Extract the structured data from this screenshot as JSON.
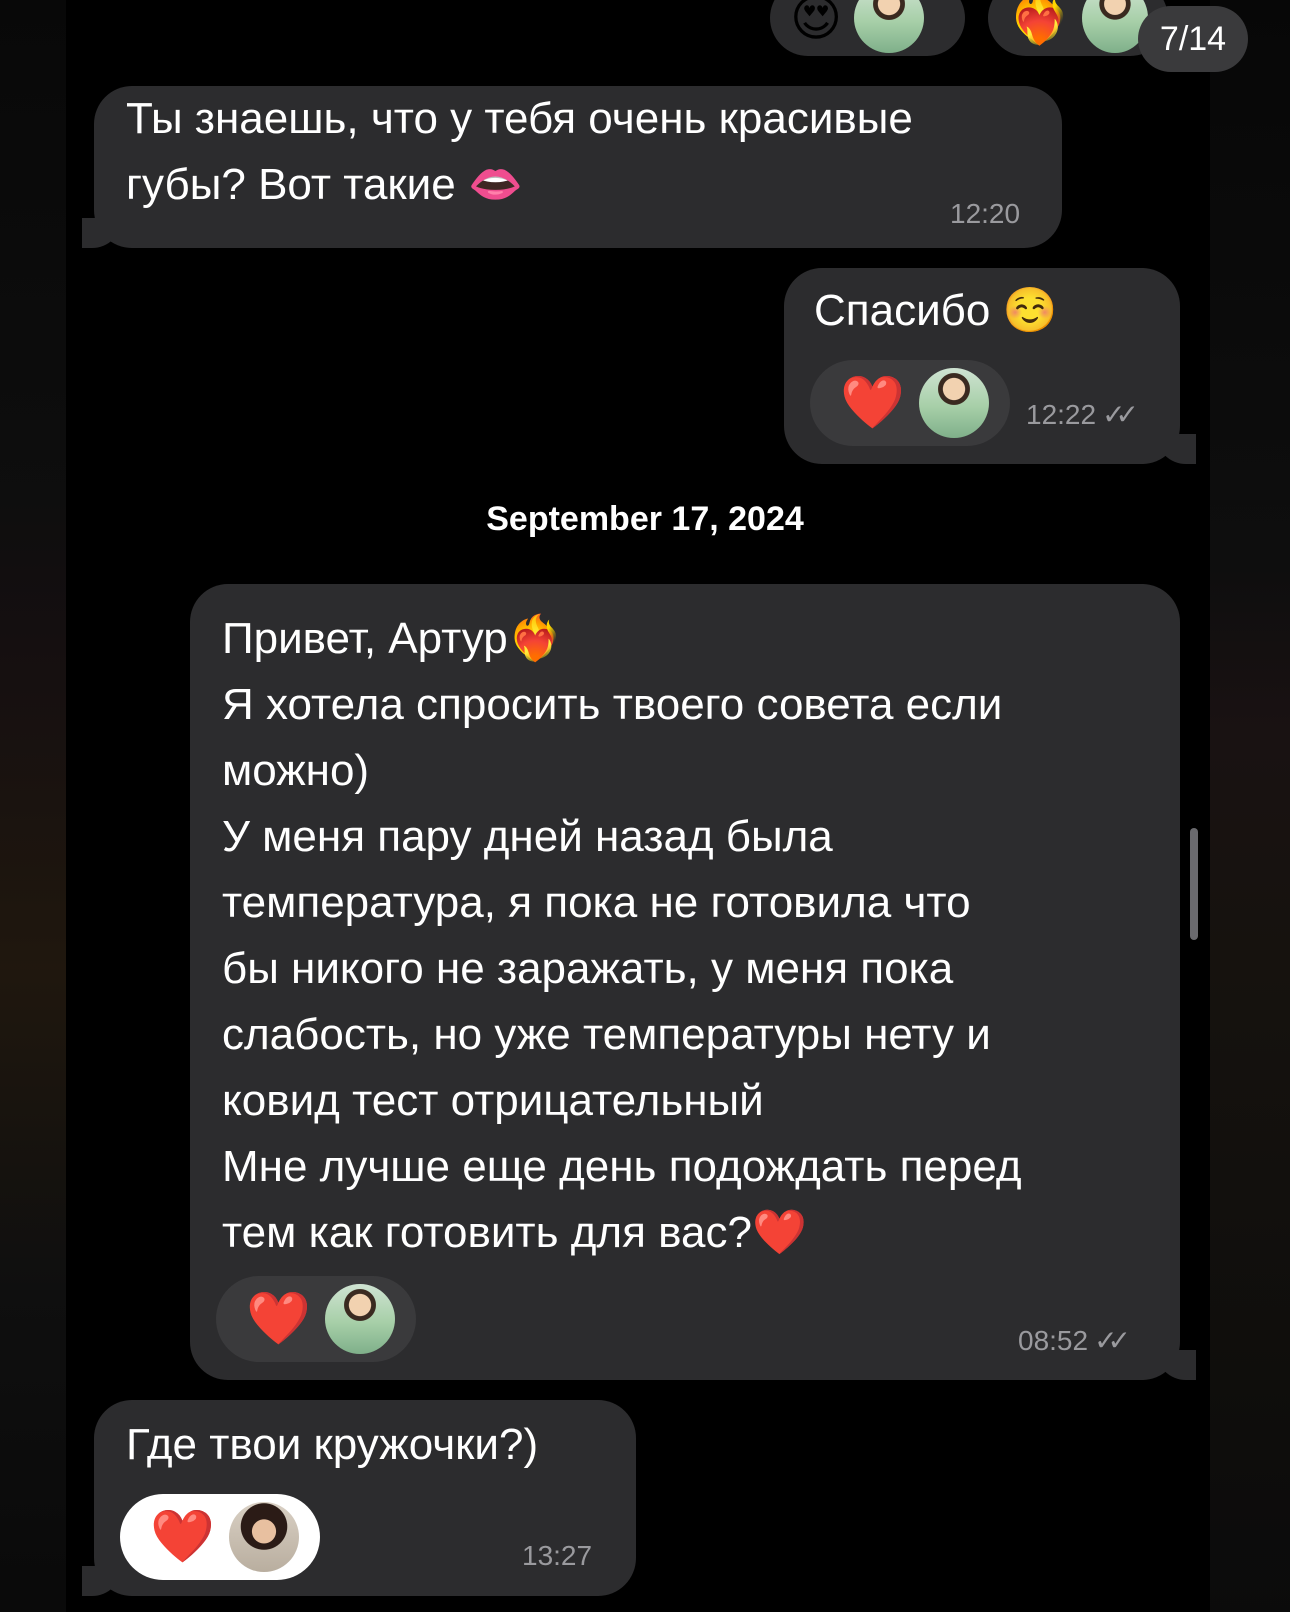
{
  "counter": "7/14",
  "top_reactions": [
    {
      "emoji": "😍"
    },
    {
      "emoji": "❤️‍🔥"
    }
  ],
  "messages": [
    {
      "text": "Ты знаешь, что у тебя очень красивые\nгубы? Вот такие 👄",
      "time": "12:20"
    },
    {
      "text": "Спасибо ☺️",
      "time": "12:22",
      "check": "✓✓",
      "reaction": "❤️"
    },
    {
      "text": "Привет, Артур❤️‍🔥\nЯ хотела спросить твоего совета если\nможно)\nУ меня пару дней назад была\nтемпература, я пока не готовила что\nбы никого не заражать, у меня пока\nслабость, но уже температуры нету и\nковид тест отрицательный\nМне лучше еще день подождать перед\nтем как готовить для вас?❤️",
      "time": "08:52",
      "check": "✓✓",
      "reaction": "❤️"
    },
    {
      "text": "Где твои кружочки?)",
      "time": "13:27",
      "reaction": "❤️"
    }
  ],
  "date_separator": "September 17, 2024"
}
